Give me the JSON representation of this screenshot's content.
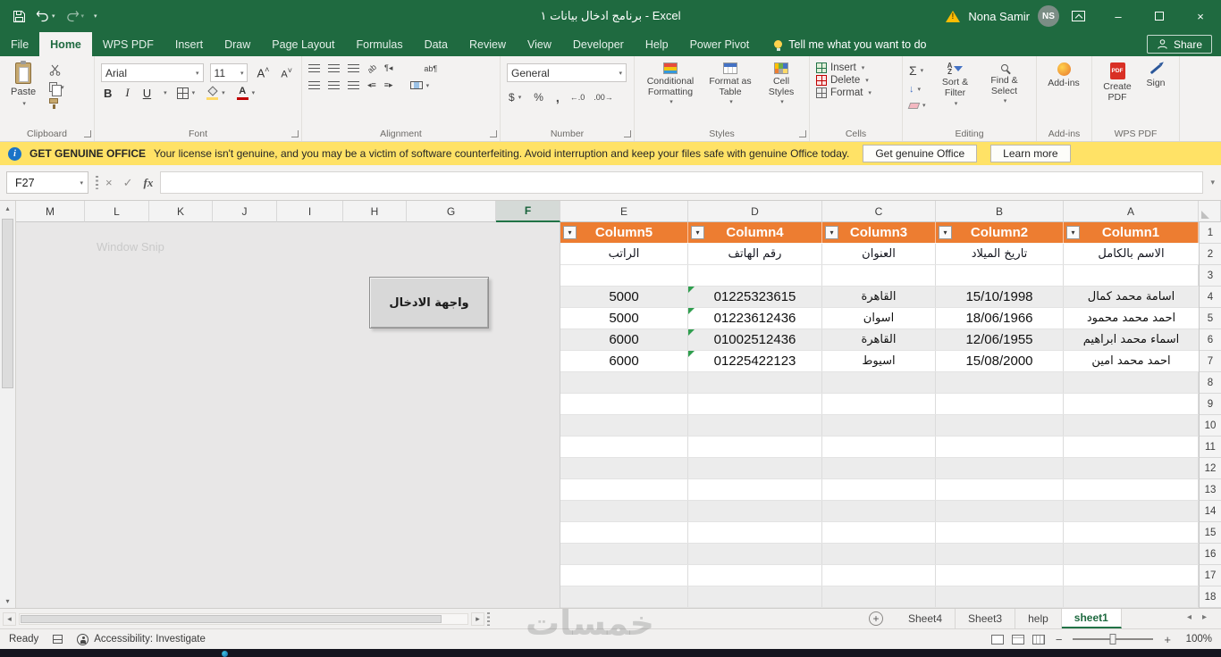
{
  "titlebar": {
    "title": "برنامج ادخال بيانات ١ - Excel",
    "user_name": "Nona Samir",
    "avatar_initials": "NS"
  },
  "tabs": {
    "items": [
      "File",
      "Home",
      "WPS PDF",
      "Insert",
      "Draw",
      "Page Layout",
      "Formulas",
      "Data",
      "Review",
      "View",
      "Developer",
      "Help",
      "Power Pivot"
    ],
    "active": "Home",
    "tell_me": "Tell me what you want to do",
    "share": "Share"
  },
  "ribbon": {
    "clipboard": {
      "label": "Clipboard",
      "paste": "Paste"
    },
    "font": {
      "label": "Font",
      "family": "Arial",
      "size": "11",
      "bold": "B",
      "italic": "I",
      "underline": "U"
    },
    "alignment": {
      "label": "Alignment"
    },
    "number": {
      "label": "Number",
      "format": "General"
    },
    "styles": {
      "label": "Styles",
      "conditional": "Conditional Formatting",
      "format_table": "Format as Table",
      "cell_styles": "Cell Styles"
    },
    "cells": {
      "label": "Cells",
      "insert": "Insert",
      "delete": "Delete",
      "format": "Format"
    },
    "editing": {
      "label": "Editing",
      "sort_filter": "Sort & Filter",
      "find_select": "Find & Select"
    },
    "addins": {
      "label": "Add-ins",
      "button": "Add-ins"
    },
    "wps": {
      "label": "WPS PDF",
      "create": "Create PDF",
      "sign": "Sign"
    }
  },
  "warning": {
    "title": "GET GENUINE OFFICE",
    "message": "Your license isn't genuine, and you may be a victim of software counterfeiting. Avoid interruption and keep your files safe with genuine Office today.",
    "button1": "Get genuine Office",
    "button2": "Learn more"
  },
  "formula_bar": {
    "name_box": "F27",
    "fx": "fx"
  },
  "sheet": {
    "columns": [
      "M",
      "L",
      "K",
      "J",
      "I",
      "H",
      "G",
      "F",
      "E",
      "D",
      "C",
      "B",
      "A"
    ],
    "selected_column": "F",
    "row_numbers": [
      "1",
      "2",
      "3",
      "4",
      "5",
      "6",
      "7",
      "8",
      "9",
      "10",
      "11",
      "12",
      "13",
      "14",
      "15",
      "16",
      "17",
      "18"
    ],
    "window_snip": "Window Snip",
    "form_button": "واجهة الادخال",
    "table": {
      "header_color": "#ED7D31",
      "headers": [
        "Column5",
        "Column4",
        "Column3",
        "Column2",
        "Column1"
      ],
      "field_names": [
        "الراتب",
        "رقم الهاتف",
        "العنوان",
        "تاريخ الميلاد",
        "الاسم بالكامل"
      ],
      "rows": [
        [
          "5000",
          "01225323615",
          "القاهرة",
          "15/10/1998",
          "اسامة محمد كمال"
        ],
        [
          "5000",
          "01223612436",
          "اسوان",
          "18/06/1966",
          "احمد محمد محمود"
        ],
        [
          "6000",
          "01002512436",
          "القاهرة",
          "12/06/1955",
          "اسماء محمد ابراهيم"
        ],
        [
          "6000",
          "01225422123",
          "اسيوط",
          "15/08/2000",
          "احمد محمد امين"
        ]
      ]
    }
  },
  "sheet_tabs": {
    "add": "+",
    "items": [
      "Sheet4",
      "Sheet3",
      "help",
      "sheet1"
    ],
    "active": "sheet1"
  },
  "status": {
    "ready": "Ready",
    "accessibility": "Accessibility: Investigate",
    "zoom": "100%"
  },
  "watermark": "خمسات",
  "colors": {
    "accent_green": "#217346",
    "table_header": "#ED7D31",
    "warning_bg": "#FFE266"
  }
}
